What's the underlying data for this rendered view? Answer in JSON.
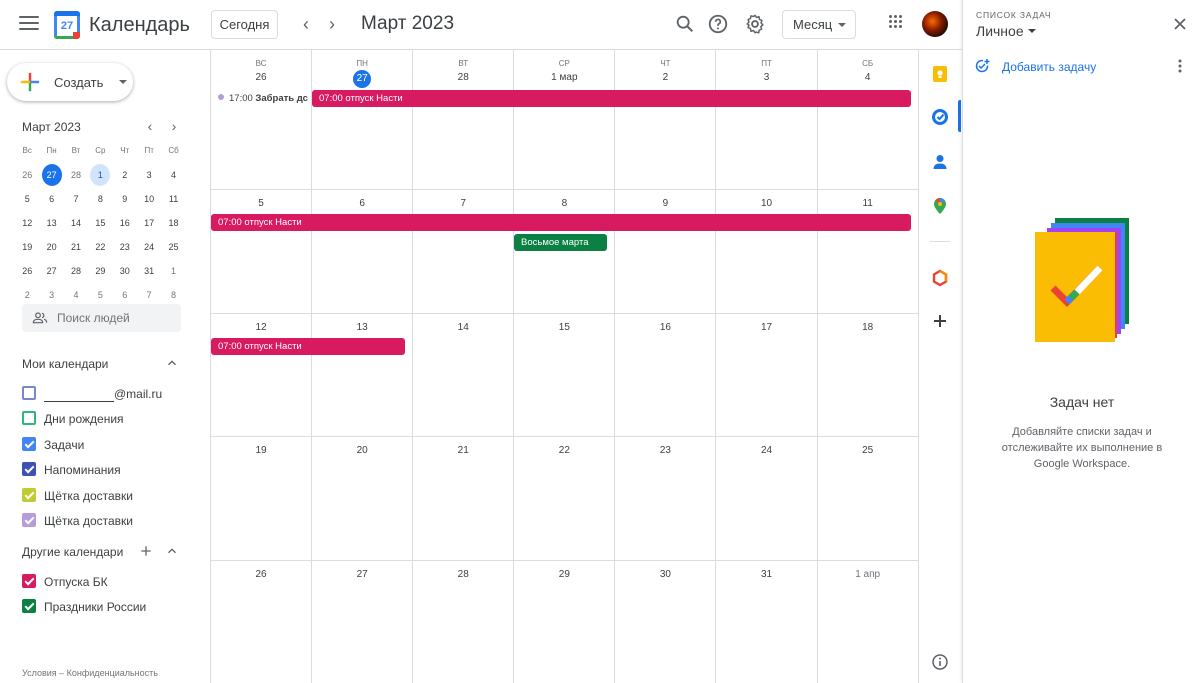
{
  "header": {
    "app_title": "Календарь",
    "logo_day": "27",
    "today_button": "Сегодня",
    "month_title": "Март 2023",
    "view_button": "Месяц"
  },
  "sidebar": {
    "create_label": "Создать",
    "mini_title": "Март 2023",
    "mini_weekdays": [
      "Вс",
      "Пн",
      "Вт",
      "Ср",
      "Чт",
      "Пт",
      "Сб"
    ],
    "mini_weeks": [
      [
        "26",
        "27",
        "28",
        "1",
        "2",
        "3",
        "4"
      ],
      [
        "5",
        "6",
        "7",
        "8",
        "9",
        "10",
        "11"
      ],
      [
        "12",
        "13",
        "14",
        "15",
        "16",
        "17",
        "18"
      ],
      [
        "19",
        "20",
        "21",
        "22",
        "23",
        "24",
        "25"
      ],
      [
        "26",
        "27",
        "28",
        "29",
        "30",
        "31",
        "1"
      ],
      [
        "2",
        "3",
        "4",
        "5",
        "6",
        "7",
        "8"
      ]
    ],
    "search_people": "Поиск людей",
    "my_calendars_title": "Мои календари",
    "my_calendars": [
      {
        "label": "@mail.ru",
        "color": "#7986cb",
        "checked": false
      },
      {
        "label": "Дни рождения",
        "color": "#33b679",
        "checked": false
      },
      {
        "label": "Задачи",
        "color": "#4285f4",
        "checked": true
      },
      {
        "label": "Напоминания",
        "color": "#3f51b5",
        "checked": true
      },
      {
        "label": "Щётка доставки",
        "color": "#c0ca33",
        "checked": true
      },
      {
        "label": "Щётка доставки",
        "color": "#b39ddb",
        "checked": true
      }
    ],
    "other_calendars_title": "Другие календари",
    "other_calendars": [
      {
        "label": "Отпуска БК",
        "color": "#d81b60",
        "checked": true
      },
      {
        "label": "Праздники России",
        "color": "#0b8043",
        "checked": true
      }
    ],
    "footer": "Условия – Конфиденциальность"
  },
  "grid": {
    "weekdays": [
      "ВС",
      "ПН",
      "ВТ",
      "СР",
      "ЧТ",
      "ПТ",
      "СБ"
    ],
    "weeks": [
      [
        "26",
        "27",
        "28",
        "1 мар",
        "2",
        "3",
        "4"
      ],
      [
        "5",
        "6",
        "7",
        "8",
        "9",
        "10",
        "11"
      ],
      [
        "12",
        "13",
        "14",
        "15",
        "16",
        "17",
        "18"
      ],
      [
        "19",
        "20",
        "21",
        "22",
        "23",
        "24",
        "25"
      ],
      [
        "26",
        "27",
        "28",
        "29",
        "30",
        "31",
        "1 апр"
      ]
    ],
    "events": {
      "reminder_time": "17:00",
      "reminder_title": "Забрать дс",
      "vacation_week1": "07:00 отпуск Насти",
      "vacation_week2": "07:00 отпуск Насти",
      "vacation_week3": "07:00 отпуск Насти",
      "womens_day": "Восьмое марта"
    },
    "colors": {
      "vacation": "#d81b60",
      "holiday": "#0b8043",
      "today": "#1a73e8"
    }
  },
  "tasks": {
    "label": "СПИСОК ЗАДАЧ",
    "list_name": "Личное",
    "add_task": "Добавить задачу",
    "empty_title": "Задач нет",
    "empty_desc": "Добавляйте списки задач и отслеживайте их выполнение в Google Workspace."
  }
}
